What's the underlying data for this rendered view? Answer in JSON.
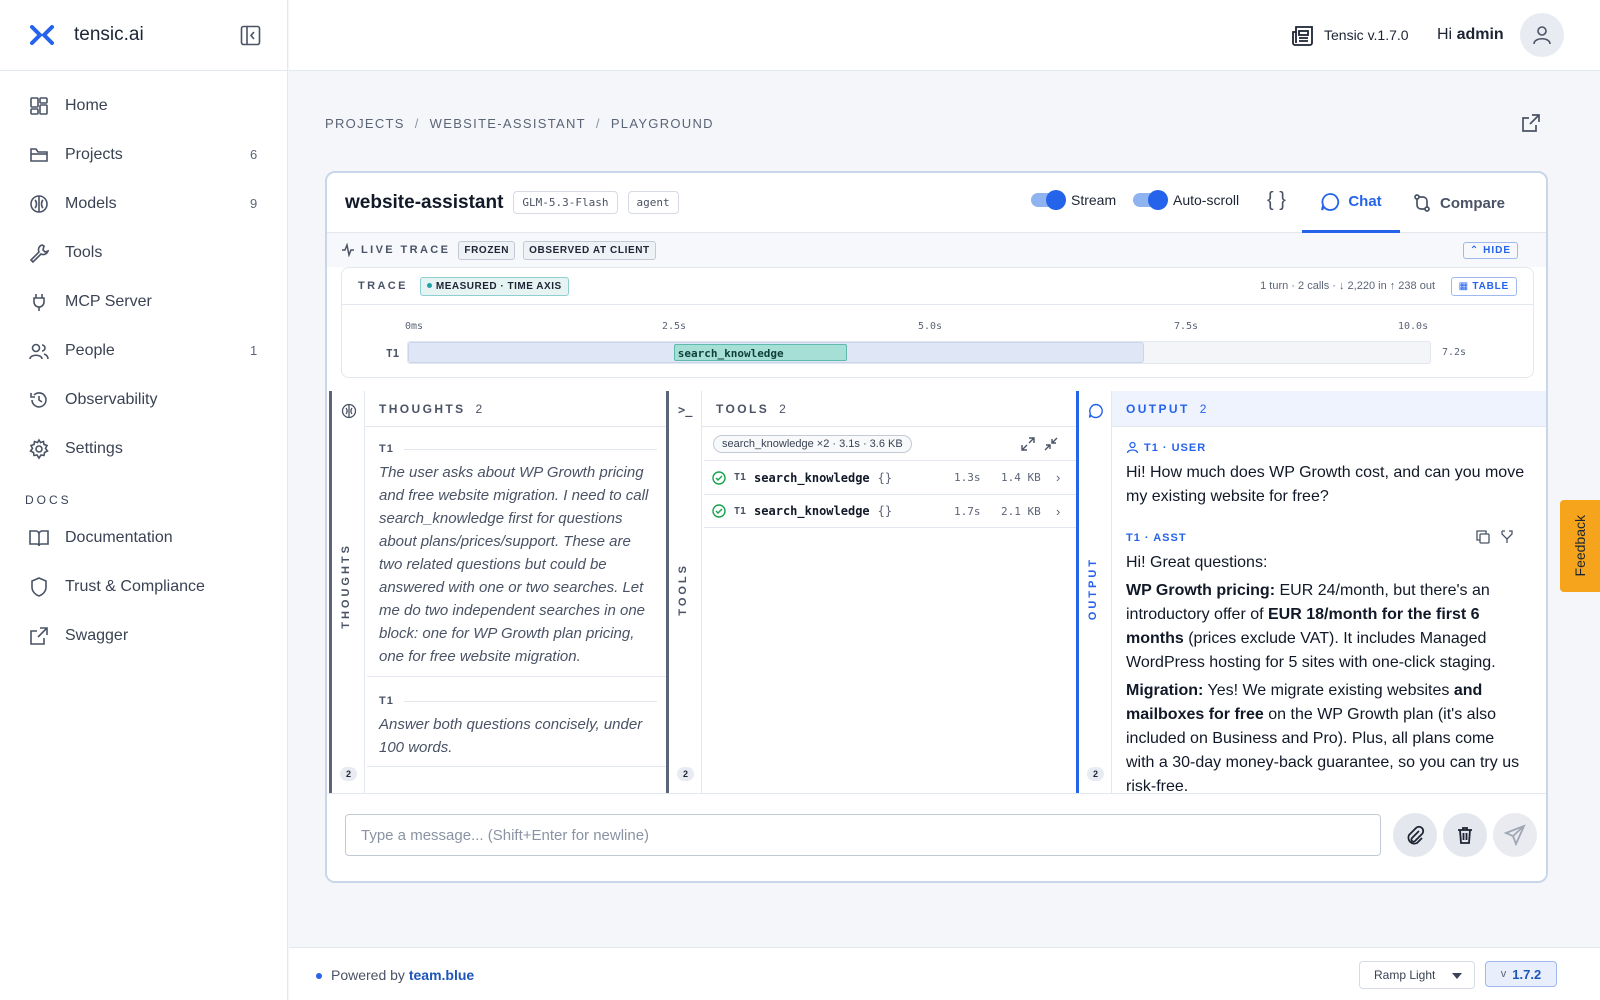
{
  "brand": {
    "name": "tensic.ai"
  },
  "sidebar": {
    "items": [
      {
        "label": "Home",
        "icon": "grid-icon",
        "count": ""
      },
      {
        "label": "Projects",
        "icon": "folder-icon",
        "count": "6"
      },
      {
        "label": "Models",
        "icon": "brain-icon",
        "count": "9"
      },
      {
        "label": "Tools",
        "icon": "wrench-icon",
        "count": ""
      },
      {
        "label": "MCP Server",
        "icon": "plug-icon",
        "count": ""
      },
      {
        "label": "People",
        "icon": "users-icon",
        "count": "1"
      },
      {
        "label": "Observability",
        "icon": "history-icon",
        "count": ""
      },
      {
        "label": "Settings",
        "icon": "gear-icon",
        "count": ""
      }
    ],
    "docs_heading": "DOCS",
    "docs": [
      {
        "label": "Documentation",
        "icon": "book-icon"
      },
      {
        "label": "Trust & Compliance",
        "icon": "shield-icon"
      },
      {
        "label": "Swagger",
        "icon": "external-link-icon"
      }
    ]
  },
  "topbar": {
    "version": "Tensic v.1.7.0",
    "greeting": "Hi",
    "user": "admin"
  },
  "breadcrumb": [
    "PROJECTS",
    "WEBSITE-ASSISTANT",
    "PLAYGROUND"
  ],
  "card": {
    "title": "website-assistant",
    "tags": [
      "GLM-5.3-Flash",
      "agent"
    ],
    "stream_label": "Stream",
    "autoscroll_label": "Auto-scroll",
    "stream_on": true,
    "autoscroll_on": true,
    "braces": "{ }",
    "tab_chat": "Chat",
    "tab_compare": "Compare"
  },
  "live_trace": {
    "label": "LIVE TRACE",
    "chips": [
      "FROZEN",
      "OBSERVED AT CLIENT"
    ],
    "hide": "HIDE",
    "trace_label": "TRACE",
    "measured": "MEASURED · TIME AXIS",
    "stats": "1 turn · 2 calls  ·  ↓ 2,220 in  ↑ 238 out",
    "table_btn": "TABLE",
    "ticks": [
      "0ms",
      "2.5s",
      "5.0s",
      "7.5s",
      "10.0s"
    ],
    "row_label": "T1",
    "call_label": "search_knowledge",
    "total": "7.2s",
    "turn_duration_s": 7.2,
    "call_start_s": 2.6,
    "call_end_s": 4.3,
    "axis_max_s": 10
  },
  "thoughts": {
    "title": "THOUGHTS",
    "count": "2",
    "rail_label": "THOUGHTS",
    "badge": "2",
    "items": [
      {
        "turn": "T1",
        "text": "The user asks about WP Growth pricing and free website migration. I need to call search_knowledge first for questions about plans/prices/support. These are two related questions but could be answered with one or two searches. Let me do two independent searches in one block: one for WP Growth plan pricing, one for free website migration."
      },
      {
        "turn": "T1",
        "text": "Answer both questions concisely, under 100 words."
      }
    ]
  },
  "tools": {
    "title": "TOOLS",
    "count": "2",
    "rail_label": "TOOLS",
    "badge": "2",
    "summary": "search_knowledge ×2 · 3.1s · 3.6 KB",
    "rows": [
      {
        "turn": "T1",
        "name": "search_knowledge",
        "args": "{}",
        "duration": "1.3s",
        "size": "1.4 KB"
      },
      {
        "turn": "T1",
        "name": "search_knowledge",
        "args": "{}",
        "duration": "1.7s",
        "size": "2.1 KB"
      }
    ]
  },
  "output": {
    "title": "OUTPUT",
    "count": "2",
    "rail_label": "OUTPUT",
    "badge": "2",
    "user_header": "T1 · USER",
    "user_text": "Hi! How much does WP Growth cost, and can you move my existing website for free?",
    "asst_header": "T1 · ASST",
    "asst_p1": "Hi! Great questions:",
    "asst_p2_b1": "WP Growth pricing:",
    "asst_p2_t1": " EUR 24/month, but there's an introductory offer of ",
    "asst_p2_b2": "EUR 18/month for the first 6 months",
    "asst_p2_t2": " (prices exclude VAT). It includes Managed WordPress hosting for 5 sites with one-click staging.",
    "asst_p3_b1": "Migration:",
    "asst_p3_t1": " Yes! We migrate existing websites ",
    "asst_p3_b2": "and mailboxes for free",
    "asst_p3_t2": " on the WP Growth plan (it's also included on Business and Pro). Plus, all plans come with a 30-day money-back guarantee, so you can try us risk-free."
  },
  "composer": {
    "placeholder": "Type a message... (Shift+Enter for newline)"
  },
  "feedback": "Feedback",
  "footer": {
    "powered": "Powered by",
    "brand": "team.blue",
    "theme": "Ramp Light",
    "v_prefix": "v",
    "version": "1.7.2"
  },
  "colors": {
    "accent": "#2563eb",
    "feedback": "#f5a41b",
    "trace_call": "#a6dfd6"
  }
}
